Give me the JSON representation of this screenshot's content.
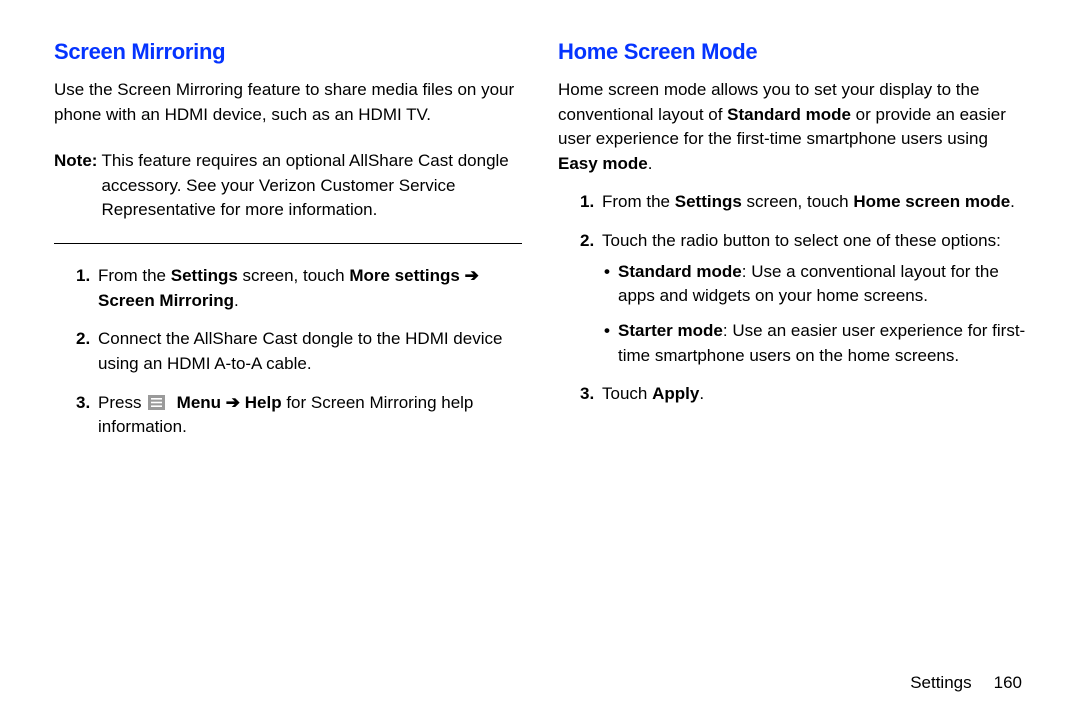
{
  "left": {
    "heading": "Screen Mirroring",
    "intro": "Use the Screen Mirroring feature to share media files on your phone with an HDMI device, such as an HDMI TV.",
    "note_label": "Note:",
    "note_body": "This feature requires an optional AllShare Cast dongle accessory. See your Verizon Customer Service Representative for more information.",
    "steps": {
      "s1_a": "From the ",
      "s1_b": "Settings",
      "s1_c": " screen, touch ",
      "s1_d": "More settings",
      "s1_e": "Screen Mirroring",
      "s1_f": ".",
      "s2": "Connect the AllShare Cast dongle to the HDMI device using an HDMI A-to-A cable.",
      "s3_a": "Press ",
      "s3_b": "Menu",
      "s3_c": "Help",
      "s3_d": " for Screen Mirroring help information."
    }
  },
  "right": {
    "heading": "Home Screen Mode",
    "intro_a": "Home screen mode allows you to set your display to the conventional layout of ",
    "intro_b": "Standard mode",
    "intro_c": " or provide an easier user experience for the first-time smartphone users using ",
    "intro_d": "Easy mode",
    "intro_e": ".",
    "steps": {
      "s1_a": "From the ",
      "s1_b": "Settings",
      "s1_c": " screen, touch ",
      "s1_d": "Home screen mode",
      "s1_e": ".",
      "s2": "Touch the radio button to select one of these options:",
      "b1_a": "Standard mode",
      "b1_b": ": Use a conventional layout for the apps and widgets on your home screens.",
      "b2_a": "Starter mode",
      "b2_b": ": Use an easier user experience for first-time smartphone users on the home screens.",
      "s3_a": "Touch ",
      "s3_b": "Apply",
      "s3_c": "."
    }
  },
  "arrow": " ➔ ",
  "footer": {
    "section": "Settings",
    "page": "160"
  }
}
